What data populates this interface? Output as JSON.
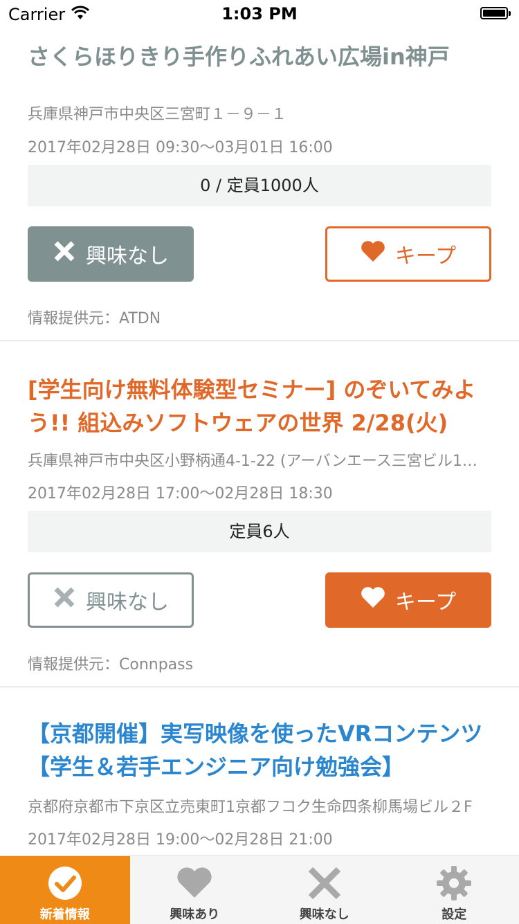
{
  "status_bar": {
    "carrier": "Carrier",
    "time": "1:03 PM"
  },
  "events": [
    {
      "title": "さくらほりきり手作りふれあい広場in神戸",
      "address": "兵庫県神戸市中央区三宮町１－９－１",
      "date": "2017年02月28日 09:30〜03月01日 16:00",
      "capacity": "0 / 定員1000人",
      "ignore_label": "興味なし",
      "keep_label": "キープ",
      "source": "情報提供元：ATDN",
      "title_color": "#809090"
    },
    {
      "title": "[学生向け無料体験型セミナー] のぞいてみよう!! 組込みソフトウェアの世界 2/28(火)",
      "address": "兵庫県神戸市中央区小野柄通4-1-22 (アーバンエース三宮ビル1…",
      "date": "2017年02月28日 17:00〜02月28日 18:30",
      "capacity": "定員6人",
      "ignore_label": "興味なし",
      "keep_label": "キープ",
      "source": "情報提供元：Connpass",
      "title_color": "#e0692a"
    },
    {
      "title": "【京都開催】実写映像を使ったVRコンテンツ【学生＆若手エンジニア向け勉強会】",
      "address": "京都府京都市下京区立売東町1京都フコク生命四条柳馬場ビル２F",
      "date": "2017年02月28日 19:00〜02月28日 21:00",
      "title_color": "#2a86cf"
    }
  ],
  "tabs": [
    {
      "label": "新着情報",
      "icon": "check-circle-icon",
      "active": true
    },
    {
      "label": "興味あり",
      "icon": "heart-icon"
    },
    {
      "label": "興味なし",
      "icon": "x-icon"
    },
    {
      "label": "設定",
      "icon": "gear-icon"
    }
  ],
  "colors": {
    "accent_orange": "#e0692a",
    "tab_active": "#f08a17",
    "gray_button": "#7f9291",
    "blue_title": "#2a86cf"
  }
}
